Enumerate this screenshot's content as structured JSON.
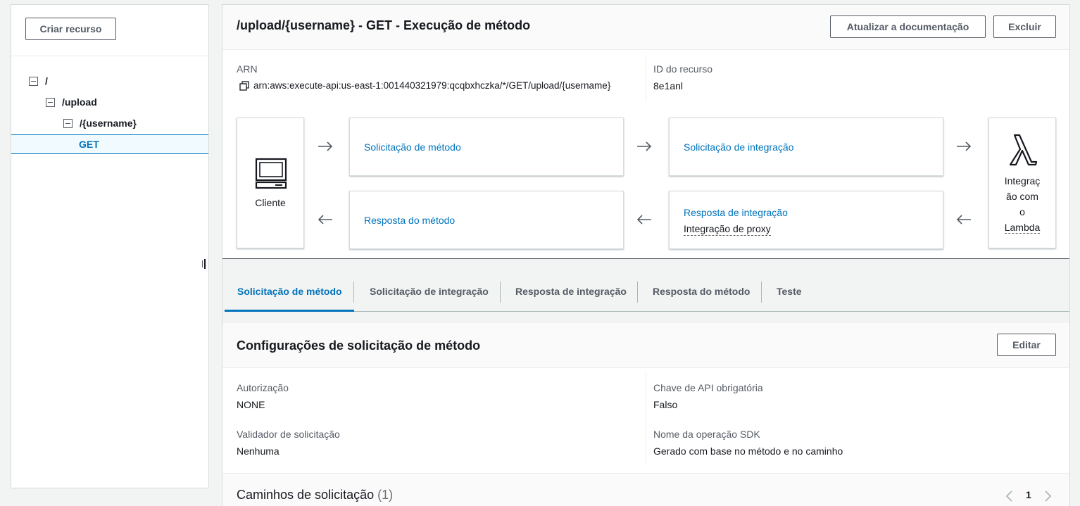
{
  "sidebar": {
    "create_resource_label": "Criar recurso",
    "tree": [
      {
        "label": "/",
        "level": 0,
        "expanded": true
      },
      {
        "label": "/upload",
        "level": 1,
        "expanded": true
      },
      {
        "label": "/{username}",
        "level": 2,
        "expanded": true
      },
      {
        "label": "GET",
        "level": 3,
        "selected": true
      }
    ]
  },
  "header": {
    "title": "/upload/{username} - GET - Execução de método",
    "update_docs_label": "Atualizar a documentação",
    "delete_label": "Excluir"
  },
  "details": {
    "arn_label": "ARN",
    "arn_value": "arn:aws:execute-api:us-east-1:001440321979:qcqbxhczka/*/GET/upload/{username}",
    "resource_id_label": "ID do recurso",
    "resource_id_value": "8e1anl"
  },
  "flow": {
    "client_label": "Cliente",
    "method_request": "Solicitação de método",
    "integration_request": "Solicitação de integração",
    "method_response": "Resposta do método",
    "integration_response": "Resposta de integração",
    "integration_response_sub": "Integração de proxy",
    "lambda_line1": "Integraç",
    "lambda_line2": "ão com",
    "lambda_line3": "o",
    "lambda_line4": "Lambda",
    "lambda_symbol": "λ"
  },
  "tabs": [
    {
      "label": "Solicitação de método",
      "active": true
    },
    {
      "label": "Solicitação de integração"
    },
    {
      "label": "Resposta de integração"
    },
    {
      "label": "Resposta do método"
    },
    {
      "label": "Teste"
    }
  ],
  "settings": {
    "title": "Configurações de solicitação de método",
    "edit_label": "Editar",
    "authorization_label": "Autorização",
    "authorization_value": "NONE",
    "api_key_label": "Chave de API obrigatória",
    "api_key_value": "Falso",
    "validator_label": "Validador de solicitação",
    "validator_value": "Nenhuma",
    "sdk_label": "Nome da operação SDK",
    "sdk_value": "Gerado com base no método e no caminho"
  },
  "paths": {
    "title": "Caminhos de solicitação",
    "count": "(1)",
    "page": "1"
  },
  "colors": {
    "link": "#0073bb",
    "text": "#16191f",
    "muted": "#545b64",
    "background": "#f2f3f3"
  }
}
